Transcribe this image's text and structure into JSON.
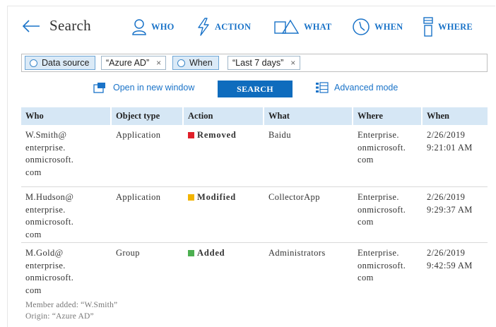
{
  "header": {
    "title": "Search",
    "categories": [
      {
        "label": "WHO",
        "icon": "person-icon"
      },
      {
        "label": "ACTION",
        "icon": "lightning-icon"
      },
      {
        "label": "WHAT",
        "icon": "shapes-icon"
      },
      {
        "label": "WHEN",
        "icon": "clock-icon"
      },
      {
        "label": "WHERE",
        "icon": "location-icon"
      }
    ]
  },
  "filters": [
    {
      "key": "Data source",
      "value": "“Azure AD”",
      "remove": "×"
    },
    {
      "key": "When",
      "value": "“Last 7 days”",
      "remove": "×"
    }
  ],
  "actions": {
    "open_new": "Open in new window",
    "search": "SEARCH",
    "advanced": "Advanced mode"
  },
  "colors": {
    "accent": "#1a73c8",
    "search_button": "#0f6cbd",
    "header_bg": "#d6e7f5",
    "removed": "#e0202a",
    "modified": "#f2b400",
    "added": "#4caf50"
  },
  "table": {
    "columns": [
      "Who",
      "Object type",
      "Action",
      "What",
      "Where",
      "When"
    ],
    "rows": [
      {
        "who": [
          "W.Smith@",
          "enterprise.",
          "onmicrosoft.",
          "com"
        ],
        "type": "Application",
        "action": "Removed",
        "action_color": "#e0202a",
        "what": "Baidu",
        "where": [
          "Enterprise.",
          "onmicrosoft.",
          "com"
        ],
        "when": [
          "2/26/2019",
          "9:21:01 AM"
        ]
      },
      {
        "who": [
          "M.Hudson@",
          "enterprise.",
          "onmicrosoft.",
          "com"
        ],
        "type": "Application",
        "action": "Modified",
        "action_color": "#f2b400",
        "what": "CollectorApp",
        "where": [
          "Enterprise.",
          "onmicrosoft.",
          "com"
        ],
        "when": [
          "2/26/2019",
          "9:29:37 AM"
        ]
      },
      {
        "who": [
          "M.Gold@",
          "enterprise.",
          "onmicrosoft.",
          "com"
        ],
        "type": "Group",
        "action": "Added",
        "action_color": "#4caf50",
        "what": "Administrators",
        "where": [
          "Enterprise.",
          "onmicrosoft.",
          "com"
        ],
        "when": [
          "2/26/2019",
          "9:42:59 AM"
        ],
        "note": [
          "Member added: “W.Smith”",
          "Origin: “Azure AD”"
        ]
      }
    ]
  }
}
